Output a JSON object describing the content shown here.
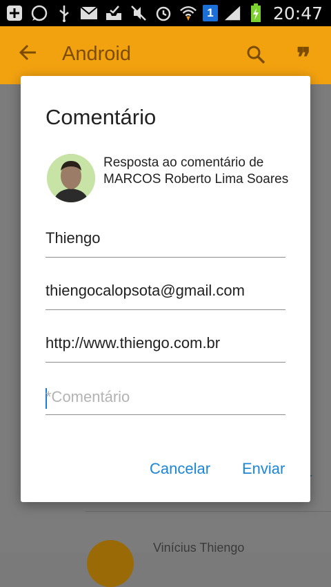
{
  "statusbar": {
    "time": "20:47",
    "sim_slot": "1",
    "icons": [
      "add-icon",
      "whatsapp-icon",
      "usb-icon",
      "mail-icon",
      "inbox-icon",
      "mute-icon",
      "alarm-icon",
      "wifi-icon",
      "sim-icon",
      "signal-icon",
      "battery-charging-icon"
    ]
  },
  "toolbar": {
    "title": "Android",
    "quote_glyph": "❞"
  },
  "background": {
    "link_fragment": "r",
    "list_name": "Vinícius Thiengo"
  },
  "dialog": {
    "title": "Comentário",
    "reply_text": "Resposta ao comentário de MARCOS Roberto Lima Soares",
    "fields": {
      "name": "Thiengo",
      "email": "thiengocalopsota@gmail.com",
      "site": "http://www.thiengo.com.br",
      "comment_placeholder": "*Comentário"
    },
    "cancel_label": "Cancelar",
    "send_label": "Enviar"
  },
  "colors": {
    "accent": "#1b86d6",
    "toolbar_dimmed": "#f3a20f",
    "scrim": "#7c7c7c"
  }
}
